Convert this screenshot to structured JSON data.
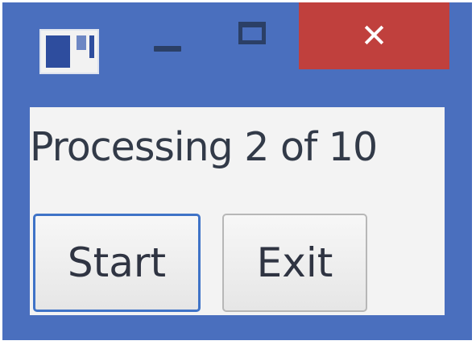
{
  "title_bar": {
    "icons": {
      "app": "app-window-icon",
      "minimize": "minimize-icon",
      "maximize": "maximize-icon",
      "close": "close-icon"
    },
    "close_glyph": "✕"
  },
  "content": {
    "status_text": "Processing 2 of 10",
    "buttons": {
      "start_label": "Start",
      "exit_label": "Exit"
    }
  },
  "colors": {
    "window_frame": "#4a6fbe",
    "close_button": "#c0403d",
    "content_background": "#f3f3f3",
    "focus_border": "#3f73c7"
  }
}
